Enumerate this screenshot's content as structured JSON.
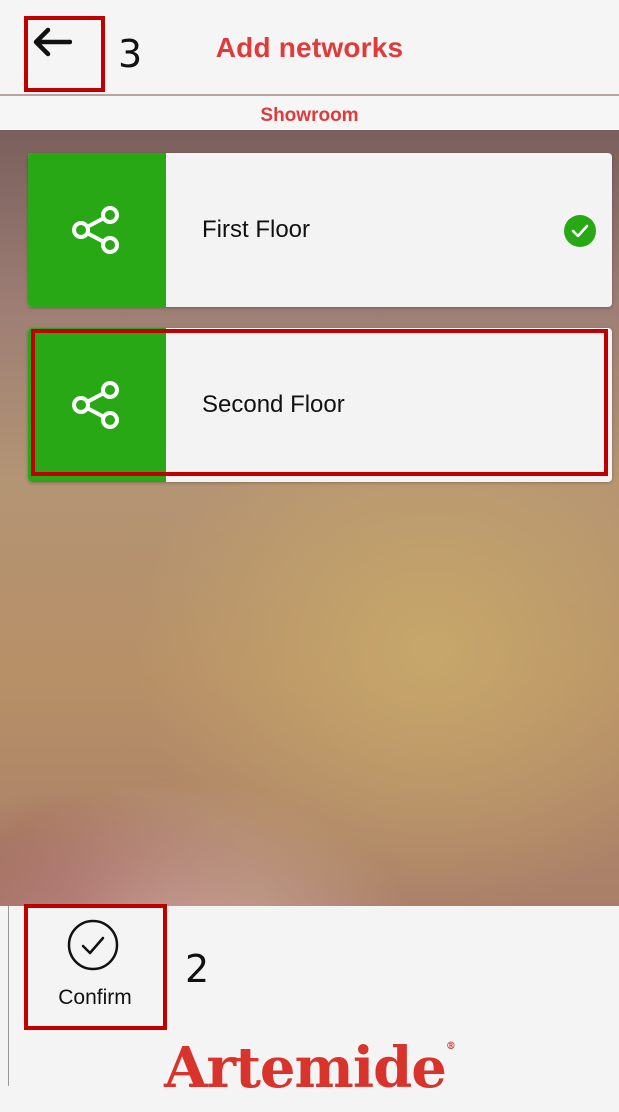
{
  "header": {
    "title": "Add networks",
    "back_icon": "arrow-left-icon"
  },
  "subheader": {
    "title": "Showroom"
  },
  "networks": [
    {
      "label": "First Floor",
      "icon": "share-icon",
      "selected": true
    },
    {
      "label": "Second Floor",
      "icon": "share-icon",
      "selected": false
    }
  ],
  "footer": {
    "confirm_label": "Confirm",
    "brand": "Artemide"
  },
  "annotations": {
    "back": "3",
    "confirm": "2"
  },
  "colors": {
    "accent_red": "#e03a3a",
    "green": "#27a814",
    "annotation_red": "#c00000"
  }
}
